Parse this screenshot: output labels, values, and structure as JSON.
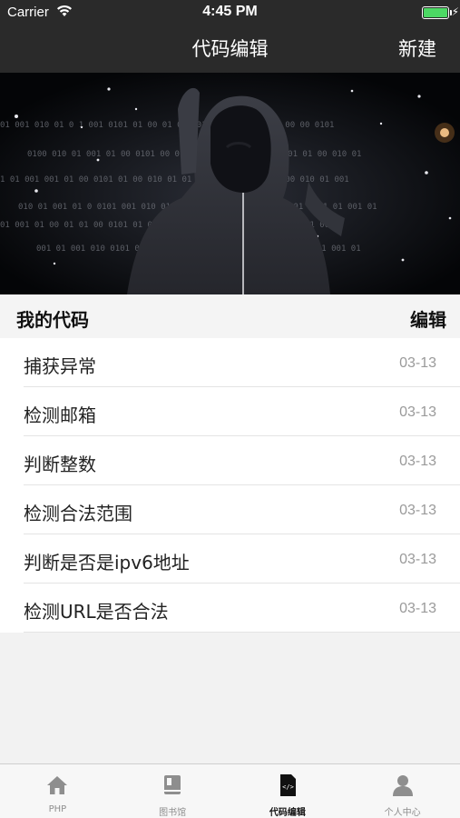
{
  "status_bar": {
    "carrier": "Carrier",
    "time": "4:45 PM",
    "battery_level": 1.0
  },
  "nav": {
    "title": "代码编辑",
    "right_button": "新建"
  },
  "hero": {
    "binary_text": "01 001 010 01 01 001 010 01 001 001 01 00 00 0101 00 0110 01 001 01 001 00 001 01 0"
  },
  "section": {
    "title": "我的代码",
    "edit_label": "编辑"
  },
  "code_list": [
    {
      "name": "捕获异常",
      "date": "03-13"
    },
    {
      "name": "检测邮箱",
      "date": "03-13"
    },
    {
      "name": "判断整数",
      "date": "03-13"
    },
    {
      "name": "检测合法范围",
      "date": "03-13"
    },
    {
      "name": "判断是否是ipv6地址",
      "date": "03-13"
    },
    {
      "name": "检测URL是否合法",
      "date": "03-13"
    }
  ],
  "tabs": [
    {
      "label": "PHP",
      "icon": "home-icon",
      "active": false
    },
    {
      "label": "图书馆",
      "icon": "book-icon",
      "active": false
    },
    {
      "label": "代码编辑",
      "icon": "code-file-icon",
      "active": true
    },
    {
      "label": "个人中心",
      "icon": "user-icon",
      "active": false
    }
  ],
  "colors": {
    "nav_background": "#2a2a2a",
    "battery": "#4cd964",
    "list_date": "#9a9a9a"
  }
}
